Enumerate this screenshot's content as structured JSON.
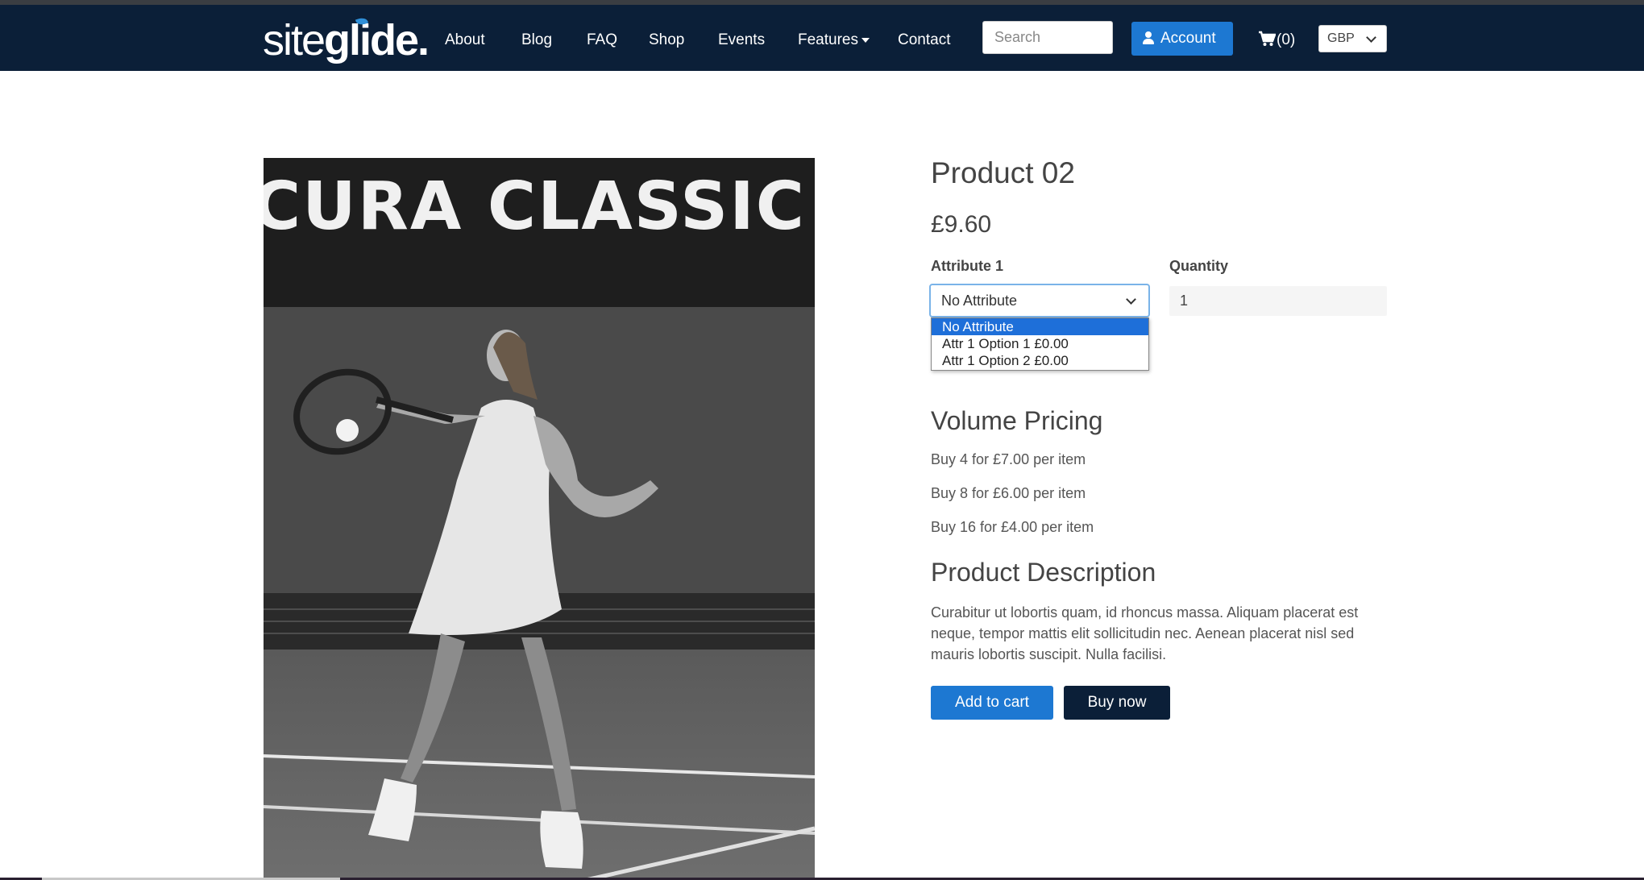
{
  "navbar": {
    "logo": {
      "part1": "site",
      "part2": "glide."
    },
    "items": [
      {
        "label": "About"
      },
      {
        "label": "Blog"
      },
      {
        "label": "FAQ"
      },
      {
        "label": "Shop"
      },
      {
        "label": "Events"
      },
      {
        "label": "Features"
      },
      {
        "label": "Contact"
      }
    ],
    "search_placeholder": "Search",
    "account_label": "Account",
    "cart_label": "(0)",
    "currency": "GBP"
  },
  "product": {
    "image_banner_text": "CURA CLASSIC",
    "title": "Product 02",
    "price": "£9.60",
    "attribute_label": "Attribute 1",
    "attribute_selected": "No Attribute",
    "attribute_options": [
      "No Attribute",
      "Attr 1 Option 1 £0.00",
      "Attr 1 Option 2 £0.00"
    ],
    "quantity_label": "Quantity",
    "quantity_value": "1",
    "volume_pricing": {
      "heading": "Volume Pricing",
      "tiers": [
        "Buy 4 for £7.00 per item",
        "Buy 8 for £6.00 per item",
        "Buy 16 for £4.00 per item"
      ]
    },
    "description": {
      "heading": "Product Description",
      "text": "Curabitur ut lobortis quam, id rhoncus massa. Aliquam placerat est neque, tempor mattis elit sollicitudin nec. Aenean placerat nisl sed mauris lobortis suscipit. Nulla facilisi."
    },
    "add_to_cart_label": "Add to cart",
    "buy_now_label": "Buy now"
  },
  "colors": {
    "navbar_bg": "#0b1f38",
    "primary_blue": "#1d78d2",
    "dark_button": "#0b1f38",
    "dropdown_highlight": "#1e6fd9"
  }
}
